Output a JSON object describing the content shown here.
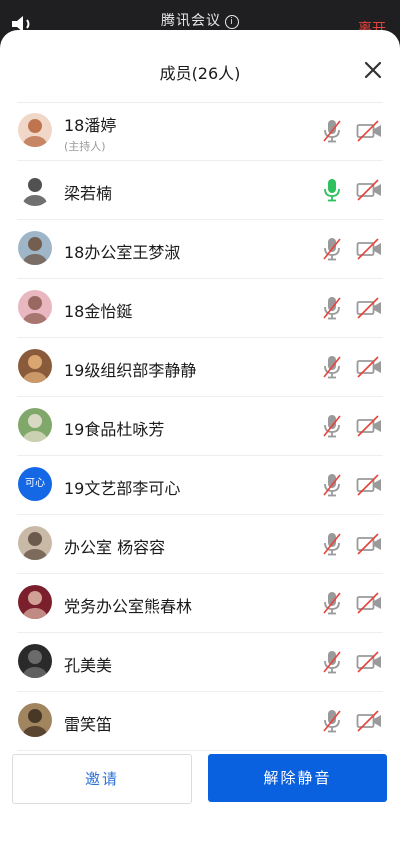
{
  "app": {
    "title": "腾讯会议",
    "end_label": "离开"
  },
  "sheet": {
    "title": "成员(26人)"
  },
  "members": [
    {
      "name": "18潘婷",
      "role": "(主持人)",
      "mic": "muted",
      "avatar": {
        "kind": "photo",
        "bg": "#f1d7c8",
        "fg": "#b5643a"
      }
    },
    {
      "name": "梁若楠",
      "role": "",
      "mic": "active",
      "avatar": {
        "kind": "photo",
        "bg": "#ffffff",
        "fg": "#333333"
      }
    },
    {
      "name": "18办公室王梦淑",
      "role": "",
      "mic": "muted",
      "avatar": {
        "kind": "photo",
        "bg": "#9fb6c9",
        "fg": "#6b4f3b"
      }
    },
    {
      "name": "18金怡鋋",
      "role": "",
      "mic": "muted",
      "avatar": {
        "kind": "photo",
        "bg": "#e9b7c0",
        "fg": "#8b5a4f"
      }
    },
    {
      "name": "19级组织部李静静",
      "role": "",
      "mic": "muted",
      "avatar": {
        "kind": "photo",
        "bg": "#8a5b3a",
        "fg": "#e6b37a"
      }
    },
    {
      "name": "19食品杜咏芳",
      "role": "",
      "mic": "muted",
      "avatar": {
        "kind": "photo",
        "bg": "#7fa86a",
        "fg": "#e9e2d2"
      }
    },
    {
      "name": "19文艺部李可心",
      "role": "",
      "mic": "muted",
      "avatar": {
        "kind": "text",
        "text": "可心",
        "bg": "#1468e6",
        "fg": "#ffffff"
      }
    },
    {
      "name": "办公室 杨容容",
      "role": "",
      "mic": "muted",
      "avatar": {
        "kind": "photo",
        "bg": "#c9b9a7",
        "fg": "#5b4a3d"
      }
    },
    {
      "name": "党务办公室熊春林",
      "role": "",
      "mic": "muted",
      "avatar": {
        "kind": "photo",
        "bg": "#7b1f2d",
        "fg": "#e0b8a8"
      }
    },
    {
      "name": "孔美美",
      "role": "",
      "mic": "muted",
      "avatar": {
        "kind": "photo",
        "bg": "#2a2a2a",
        "fg": "#777777"
      }
    },
    {
      "name": "雷笑笛",
      "role": "",
      "mic": "muted",
      "avatar": {
        "kind": "photo",
        "bg": "#a0855f",
        "fg": "#3a2a1c"
      }
    }
  ],
  "actions": {
    "invite_label": "邀请",
    "unmute_all_label": "解除静音"
  },
  "colors": {
    "accent": "#0a61e0",
    "mic_active": "#2fc15e",
    "muted_slash": "#e5433c",
    "icon_gray": "#9a9a9a"
  }
}
